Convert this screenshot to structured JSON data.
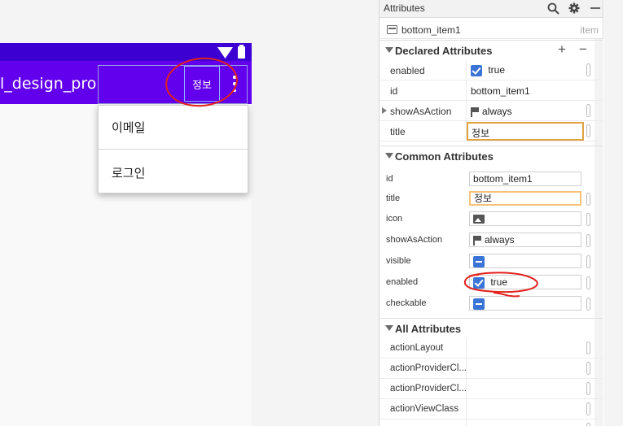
{
  "preview": {
    "app_title": "l_design_pro",
    "action_item_label": "정보",
    "menu_items": [
      "이메일",
      "로그인"
    ]
  },
  "panel": {
    "title": "Attributes",
    "component_name": "bottom_item1",
    "component_type": "item",
    "declared": {
      "title": "Declared Attributes",
      "rows": [
        {
          "name": "enabled",
          "value": "true"
        },
        {
          "name": "id",
          "value": "bottom_item1"
        },
        {
          "name": "showAsAction",
          "value": "always"
        },
        {
          "name": "title",
          "value": "정보"
        }
      ]
    },
    "common": {
      "title": "Common Attributes",
      "rows": [
        {
          "name": "id",
          "value": "bottom_item1"
        },
        {
          "name": "title",
          "value": "정보"
        },
        {
          "name": "icon",
          "value": ""
        },
        {
          "name": "showAsAction",
          "value": "always"
        },
        {
          "name": "visible",
          "value": ""
        },
        {
          "name": "enabled",
          "value": "true"
        },
        {
          "name": "checkable",
          "value": ""
        }
      ]
    },
    "all": {
      "title": "All Attributes",
      "rows": [
        {
          "name": "actionLayout"
        },
        {
          "name": "actionProviderCl..."
        },
        {
          "name": "actionProviderCl..."
        },
        {
          "name": "actionViewClass"
        }
      ]
    }
  },
  "colors": {
    "app_bar": "#6200ee",
    "status_bar": "#3d00d2",
    "annotation": "#e2211c",
    "checkbox": "#3a74d6",
    "focus_border": "#f6c27a"
  },
  "icons": [
    "search-icon",
    "gear-icon",
    "minimize-icon",
    "add-icon",
    "remove-icon",
    "wifi-icon",
    "battery-icon",
    "overflow-menu-icon",
    "flag-icon",
    "image-icon"
  ]
}
